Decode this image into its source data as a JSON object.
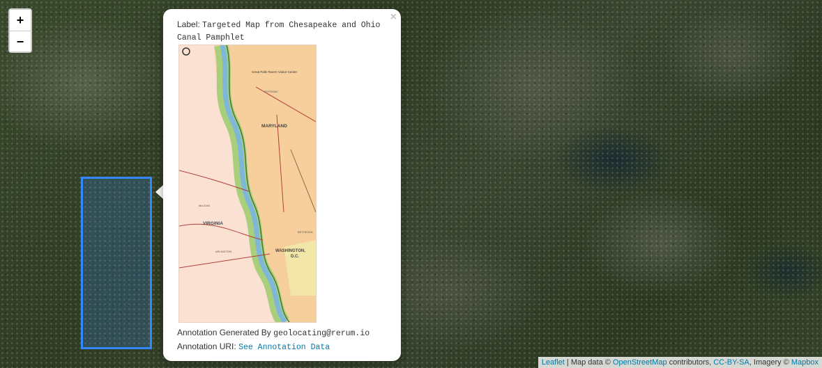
{
  "zoom": {
    "in_label": "+",
    "out_label": "−"
  },
  "popup": {
    "close_label": "×",
    "label_key": "Label:",
    "label_value": "Targeted Map from Chesapeake and Ohio Canal Pamphlet",
    "generated_key": "Annotation Generated By",
    "generated_value": "geolocating@rerum.io",
    "uri_key": "Annotation URI:",
    "uri_link": "See Annotation Data",
    "thumbnail": {
      "labels": {
        "maryland": "MARYLAND",
        "virginia": "VIRGINIA",
        "washington": "WASHINGTON,",
        "dc": "D.C.",
        "potomac": "POTOMAC",
        "visitor_center": "Great Falls Tavern Visitor Center",
        "bethesda": "BETHESDA",
        "mclean": "McLEAN",
        "arlington": "ARLINGTON"
      }
    }
  },
  "attribution": {
    "leaflet": "Leaflet",
    "sep1": " | Map data © ",
    "osm": "OpenStreetMap",
    "contrib": " contributors, ",
    "license": "CC-BY-SA",
    "imagery": ", Imagery © ",
    "mapbox": "Mapbox"
  },
  "colors": {
    "bbox": "#3388ff",
    "link": "#0078a8"
  }
}
